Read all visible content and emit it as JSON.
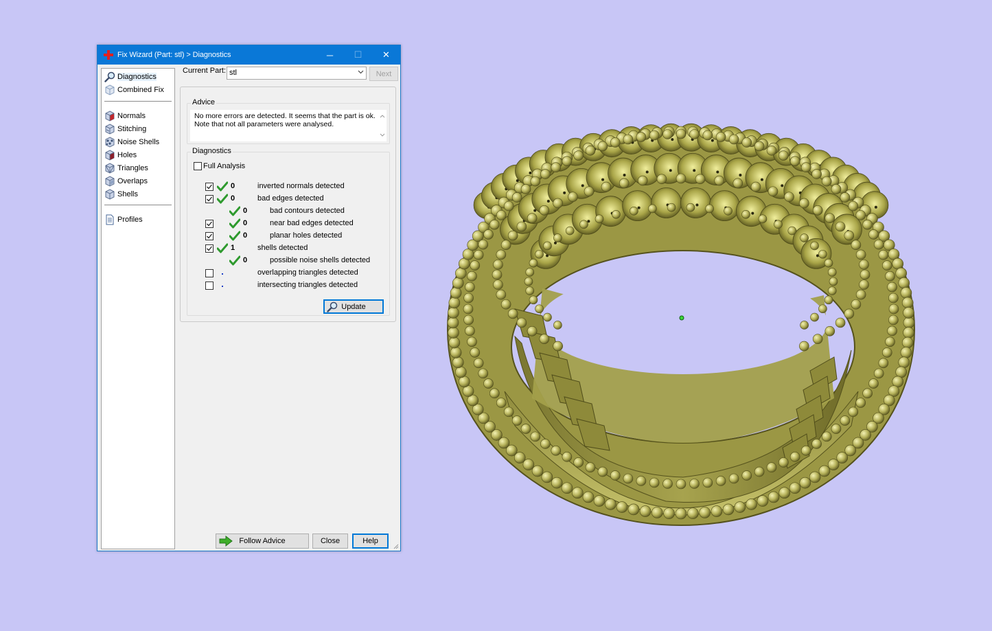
{
  "window": {
    "title": "Fix Wizard (Part: stl) > Diagnostics",
    "minimize_glyph": "─",
    "maximize_glyph": "☐",
    "close_glyph": "✕"
  },
  "nav": {
    "items": [
      {
        "label": "Diagnostics",
        "icon": "magnifier-icon"
      },
      {
        "label": "Combined Fix",
        "icon": "cube-icon"
      },
      {
        "label": "Normals",
        "icon": "normals-cube-icon"
      },
      {
        "label": "Stitching",
        "icon": "stitching-cube-icon"
      },
      {
        "label": "Noise Shells",
        "icon": "noise-shells-icon"
      },
      {
        "label": "Holes",
        "icon": "holes-cube-icon"
      },
      {
        "label": "Triangles",
        "icon": "triangles-cube-icon"
      },
      {
        "label": "Overlaps",
        "icon": "overlaps-cube-icon"
      },
      {
        "label": "Shells",
        "icon": "shells-cube-icon"
      },
      {
        "label": "Profiles",
        "icon": "profiles-document-icon"
      }
    ]
  },
  "current_part": {
    "label": "Current Part:",
    "value": "stl",
    "next_label": "Next"
  },
  "advice": {
    "title": "Advice",
    "line1": "No more errors are detected. It seems that the part is ok.",
    "line2": "Note that not all parameters were analysed."
  },
  "diagnostics": {
    "title": "Diagnostics",
    "full_analysis_label": "Full Analysis",
    "rows": [
      {
        "checked": true,
        "status": "ok",
        "count": "0",
        "label": "inverted normals detected"
      },
      {
        "checked": true,
        "status": "ok",
        "count": "0",
        "label": "bad edges detected"
      },
      {
        "checked": null,
        "status": "ok",
        "count": "0",
        "label": "bad contours detected"
      },
      {
        "checked": true,
        "status": "ok",
        "count": "0",
        "label": "near bad edges detected"
      },
      {
        "checked": true,
        "status": "ok",
        "count": "0",
        "label": "planar holes detected"
      },
      {
        "checked": true,
        "status": "ok",
        "count": "1",
        "label": "shells detected"
      },
      {
        "checked": null,
        "status": "ok",
        "count": "0",
        "label": "possible noise shells detected"
      },
      {
        "checked": false,
        "status": "none",
        "count": "",
        "label": "overlapping triangles detected"
      },
      {
        "checked": false,
        "status": "none",
        "count": "",
        "label": "intersecting triangles detected"
      }
    ],
    "update_label": "Update"
  },
  "footer": {
    "follow_advice_label": "Follow Advice",
    "close_label": "Close",
    "help_label": "Help"
  },
  "colors": {
    "desktop_bg": "#c8c6f6",
    "titlebar": "#0a78d7",
    "ring": "#a7a34e",
    "ok_check": "#2e9a2e"
  }
}
